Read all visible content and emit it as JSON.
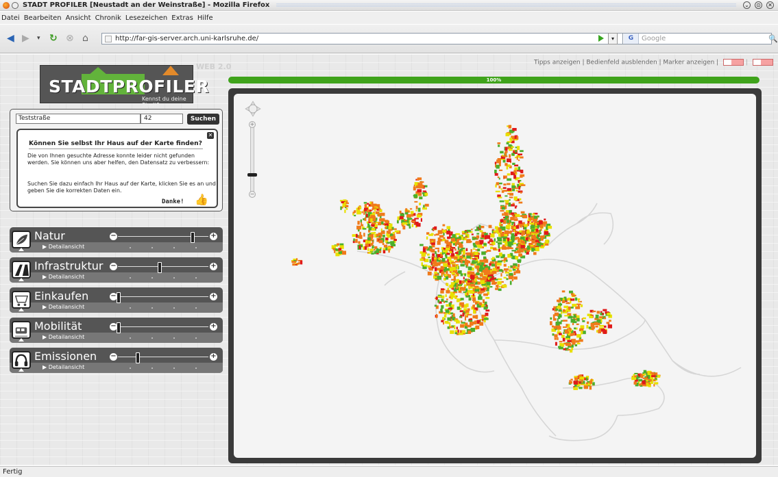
{
  "window": {
    "title": "STADT PROFILER  [Neustadt an der Weinstraße] - Mozilla Firefox"
  },
  "menu": [
    "Datei",
    "Bearbeiten",
    "Ansicht",
    "Chronik",
    "Lesezeichen",
    "Extras",
    "Hilfe"
  ],
  "nav": {
    "url": "http://far-gis-server.arch.uni-karlsruhe.de/",
    "search_placeholder": "Google",
    "search_engine_badge": "G"
  },
  "page": {
    "logo_text": "STADTPROFILER",
    "logo_tagline": "Kennst du deine Stadt?",
    "web_badge": "WEB 2.0",
    "top_links": "Tipps anzeigen | Bedienfeld ausblenden | Marker anzeigen |",
    "progress_text": "100%",
    "progress_value": 100,
    "search": {
      "street_value": "Teststraße",
      "number_value": "42",
      "button": "Suchen"
    },
    "tip": {
      "title": "Können Sie selbst Ihr Haus auf der Karte finden?",
      "paragraph1": "Die von Ihnen gesuchte Adresse konnte leider nicht gefunden werden. Sie können uns aber helfen, den Datensatz zu verbessern:",
      "paragraph2": "Suchen Sie dazu einfach Ihr Haus auf der Karte, klicken Sie es an und geben Sie die korrekten Daten ein.",
      "thanks": "Danke!",
      "close_icon": "close-icon"
    },
    "categories": [
      {
        "name": "Natur",
        "detail": "▶ Detailansicht",
        "icon": "leaf-icon",
        "slider_value": 0.86
      },
      {
        "name": "Infrastruktur",
        "detail": "▶ Detailansicht",
        "icon": "road-icon",
        "slider_value": 0.48
      },
      {
        "name": "Einkaufen",
        "detail": "▶ Detailansicht",
        "icon": "cart-icon",
        "slider_value": 0.0
      },
      {
        "name": "Mobilität",
        "detail": "▶ Detailansicht",
        "icon": "train-icon",
        "slider_value": 0.0
      },
      {
        "name": "Emissionen",
        "detail": "▶ Detailansicht",
        "icon": "headphones-icon",
        "slider_value": 0.22
      }
    ],
    "map_colors": {
      "good": "#4cae2b",
      "fair": "#e8e000",
      "medium": "#f07a1a",
      "poor": "#e01a1a",
      "road": "#d0d0d0"
    }
  },
  "status": {
    "text": "Fertig"
  }
}
